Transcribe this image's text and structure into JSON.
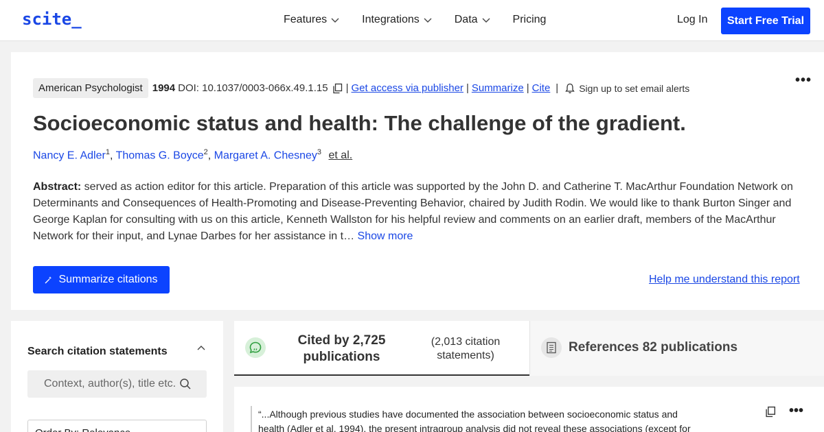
{
  "header": {
    "logo": "scite_",
    "nav": [
      {
        "label": "Features",
        "has_dropdown": true
      },
      {
        "label": "Integrations",
        "has_dropdown": true
      },
      {
        "label": "Data",
        "has_dropdown": true
      },
      {
        "label": "Pricing",
        "has_dropdown": false
      }
    ],
    "login": "Log In",
    "trial": "Start Free Trial"
  },
  "article": {
    "journal": "American Psychologist",
    "year": "1994",
    "doi": "DOI: 10.1037/0003-066x.49.1.15",
    "sep": "|",
    "get_access": "Get access via publisher",
    "summarize": "Summarize",
    "cite": "Cite",
    "alert": "Sign up to set email alerts",
    "more": "•••",
    "title": "Socioeconomic status and health: The challenge of the gradient.",
    "authors": [
      {
        "name": "Nancy E. Adler",
        "sup": "1"
      },
      {
        "name": "Thomas G. Boyce",
        "sup": "2"
      },
      {
        "name": "Margaret A. Chesney",
        "sup": "3"
      }
    ],
    "author_sep": ", ",
    "et_al": "et al.",
    "abstract_label": "Abstract:",
    "abstract_text": " served as action editor for this article. Preparation of this article was supported by the John D. and Catherine T. MacArthur Foundation Network on Determinants and Consequences of Health-Promoting and Disease-Preventing Behavior, chaired by Judith Rodin. We would like to thank Burton Singer and George Kaplan for consulting with us on this article, Kenneth Wallston for his helpful review and comments on an earlier draft, members of the MacArthur Network for their input, and Lynae Darbes for her assistance in t… ",
    "show_more": "Show more",
    "summarize_citations": "Summarize citations",
    "help": "Help me understand this report"
  },
  "search_panel": {
    "title": "Search citation statements",
    "placeholder": "Context, author(s), title etc.",
    "order_by": "Order By: Relevance"
  },
  "tabs": {
    "cited_count": "Cited by 2,725 publications",
    "cited_statements": "(2,013 citation statements)",
    "references": "References 82 publications"
  },
  "citation": {
    "text_before": "“...Although previous studies have documented the association between socioeconomic status and health (",
    "ref": "Adler et al, 1994",
    "text_after": "), the present intragroup analysis did not reveal these associations (except for",
    "more": "•••"
  },
  "colors": {
    "brand": "#1a47e5",
    "button": "#0c43ff",
    "cited_icon_bg": "#d7f0d9",
    "cited_icon_fg": "#2e9e3e"
  },
  "icons": [
    "chevron-down-icon",
    "copy-icon",
    "bell-icon",
    "more-icon",
    "sparkle-icon",
    "chevron-up-icon",
    "search-icon",
    "quote-bubble-icon",
    "document-icon"
  ]
}
